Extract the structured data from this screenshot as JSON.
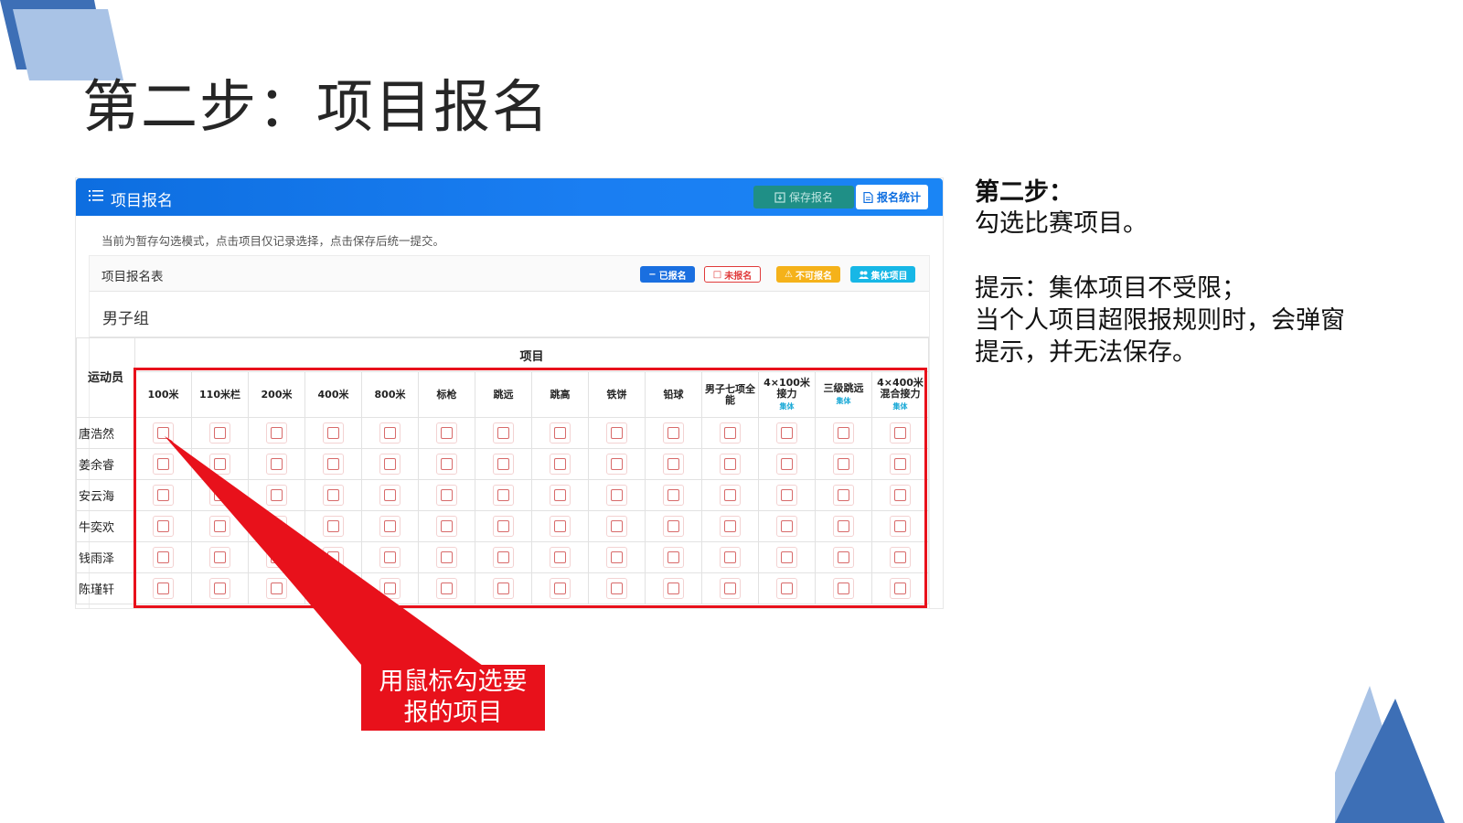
{
  "slide": {
    "title": "第二步：项目报名",
    "instructions": {
      "heading": "第二步：",
      "line1": "勾选比赛项目。",
      "tip1": "提示：集体项目不受限；",
      "tip2": "当个人项目超限报规则时，会弹窗",
      "tip3": "提示，并无法保存。"
    },
    "callout": {
      "line1": "用鼠标勾选要",
      "line2": "报的项目"
    },
    "colors": {
      "accent_red": "#e8111b",
      "deco_dark_blue": "#3d6fb6",
      "deco_light_blue": "#a9c3e6"
    }
  },
  "app": {
    "header": {
      "icon": "list-icon",
      "title": "项目报名",
      "save_button": "保存报名",
      "stats_button": "报名统计",
      "color": "#0d6ee0"
    },
    "hint": "当前为暂存勾选模式，点击项目仅记录选择，点击保存后统一提交。",
    "card": {
      "title": "项目报名表",
      "legend": {
        "registered": "已报名",
        "unregistered": "未报名",
        "forbidden": "不可报名",
        "team": "集体项目"
      }
    },
    "group": "男子组",
    "table": {
      "athlete_header": "运动员",
      "events_header": "项目",
      "team_tag": "集体",
      "events": [
        {
          "name": "100米",
          "team": false
        },
        {
          "name": "110米栏",
          "team": false
        },
        {
          "name": "200米",
          "team": false
        },
        {
          "name": "400米",
          "team": false
        },
        {
          "name": "800米",
          "team": false
        },
        {
          "name": "标枪",
          "team": false
        },
        {
          "name": "跳远",
          "team": false
        },
        {
          "name": "跳高",
          "team": false
        },
        {
          "name": "铁饼",
          "team": false
        },
        {
          "name": "铅球",
          "team": false
        },
        {
          "name": "男子七项全能",
          "team": false
        },
        {
          "name": "4×100米接力",
          "team": true
        },
        {
          "name": "三级跳远",
          "team": true
        },
        {
          "name": "4×400米混合接力",
          "team": true
        }
      ],
      "athletes": [
        "唐浩然",
        "姜余睿",
        "安云海",
        "牛奕欢",
        "钱雨泽",
        "陈瑾轩"
      ],
      "selection": [
        [
          false,
          false,
          false,
          false,
          false,
          false,
          false,
          false,
          false,
          false,
          false,
          false,
          false,
          false
        ],
        [
          false,
          false,
          false,
          false,
          false,
          false,
          false,
          false,
          false,
          false,
          false,
          false,
          false,
          false
        ],
        [
          false,
          false,
          false,
          false,
          false,
          false,
          false,
          false,
          false,
          false,
          false,
          false,
          false,
          false
        ],
        [
          false,
          false,
          false,
          false,
          false,
          false,
          false,
          false,
          false,
          false,
          false,
          false,
          false,
          false
        ],
        [
          false,
          false,
          false,
          false,
          false,
          false,
          false,
          false,
          false,
          false,
          false,
          false,
          false,
          false
        ],
        [
          false,
          false,
          false,
          false,
          false,
          false,
          false,
          false,
          false,
          false,
          false,
          false,
          false,
          false
        ]
      ]
    }
  }
}
